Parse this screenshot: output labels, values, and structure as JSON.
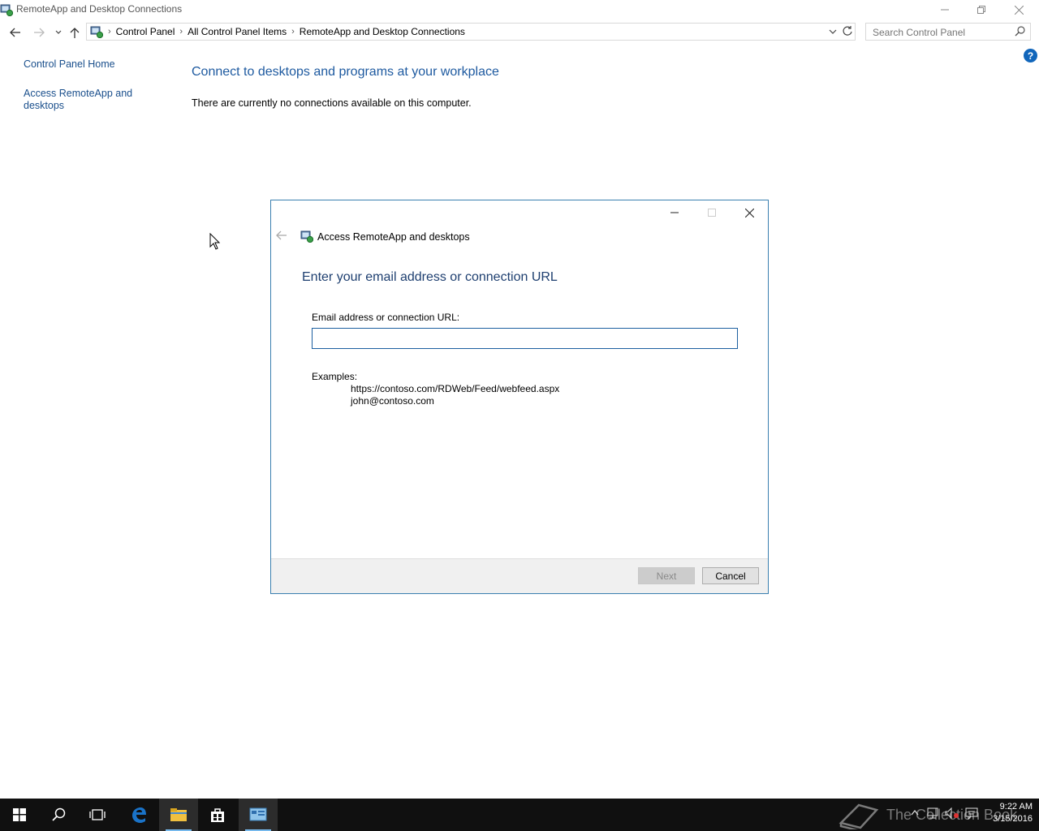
{
  "window": {
    "title": "RemoteApp and Desktop Connections"
  },
  "address": {
    "crumbs": [
      "Control Panel",
      "All Control Panel Items",
      "RemoteApp and Desktop Connections"
    ]
  },
  "search": {
    "placeholder": "Search Control Panel"
  },
  "sidebar": {
    "items": [
      {
        "label": "Control Panel Home"
      },
      {
        "label": "Access RemoteApp and desktops"
      }
    ]
  },
  "main": {
    "heading": "Connect to desktops and programs at your workplace",
    "status": "There are currently no connections available on this computer."
  },
  "dialog": {
    "title": "Access RemoteApp and desktops",
    "heading": "Enter your email address or connection URL",
    "field_label": "Email address or connection URL:",
    "field_value": "",
    "examples_label": "Examples:",
    "examples": [
      "https://contoso.com/RDWeb/Feed/webfeed.aspx",
      "john@contoso.com"
    ],
    "next_label": "Next",
    "cancel_label": "Cancel"
  },
  "taskbar": {
    "watermark": "The Collection Book",
    "time": "9:22 AM",
    "date": "3/15/2016"
  },
  "colors": {
    "link": "#1a4f8c",
    "heading": "#1e5aa0",
    "dialog_border": "#3a7fb0",
    "taskbar": "#101010"
  }
}
